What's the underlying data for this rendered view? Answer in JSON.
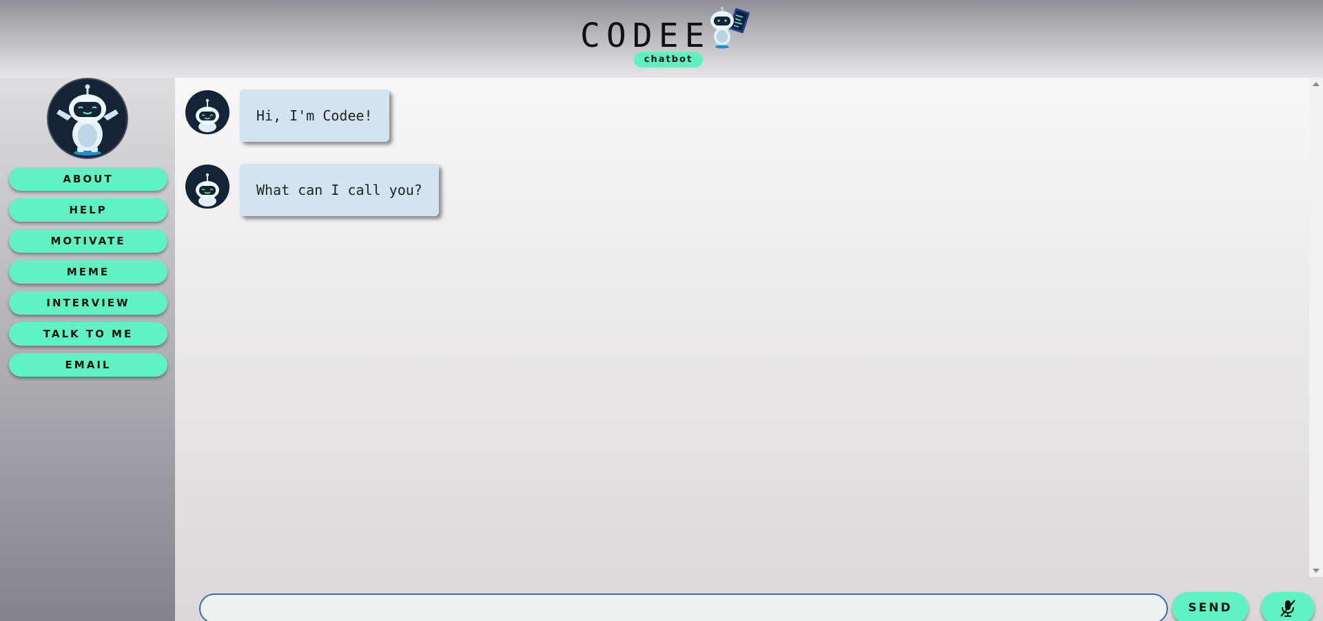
{
  "header": {
    "title": "CODEE",
    "badge": "chatbot",
    "logo_icon": "robot-with-code-sheet-icon"
  },
  "sidebar": {
    "avatar_icon": "robot-waving-icon",
    "items": [
      {
        "label": "ABOUT"
      },
      {
        "label": "HELP"
      },
      {
        "label": "MOTIVATE"
      },
      {
        "label": "MEME"
      },
      {
        "label": "INTERVIEW"
      },
      {
        "label": "TALK TO ME"
      },
      {
        "label": "EMAIL"
      }
    ]
  },
  "chat": {
    "messages": [
      {
        "sender": "bot",
        "text": "Hi, I'm Codee!"
      },
      {
        "sender": "bot",
        "text": "What can I call you?"
      }
    ]
  },
  "composer": {
    "input_value": "",
    "send_label": "SEND",
    "mic_icon": "microphone-muted-icon"
  },
  "colors": {
    "accent": "#5ff3c3",
    "bubble": "#d2e4f0",
    "avatar_bg": "#142436",
    "input_border": "#2a6fb5"
  }
}
